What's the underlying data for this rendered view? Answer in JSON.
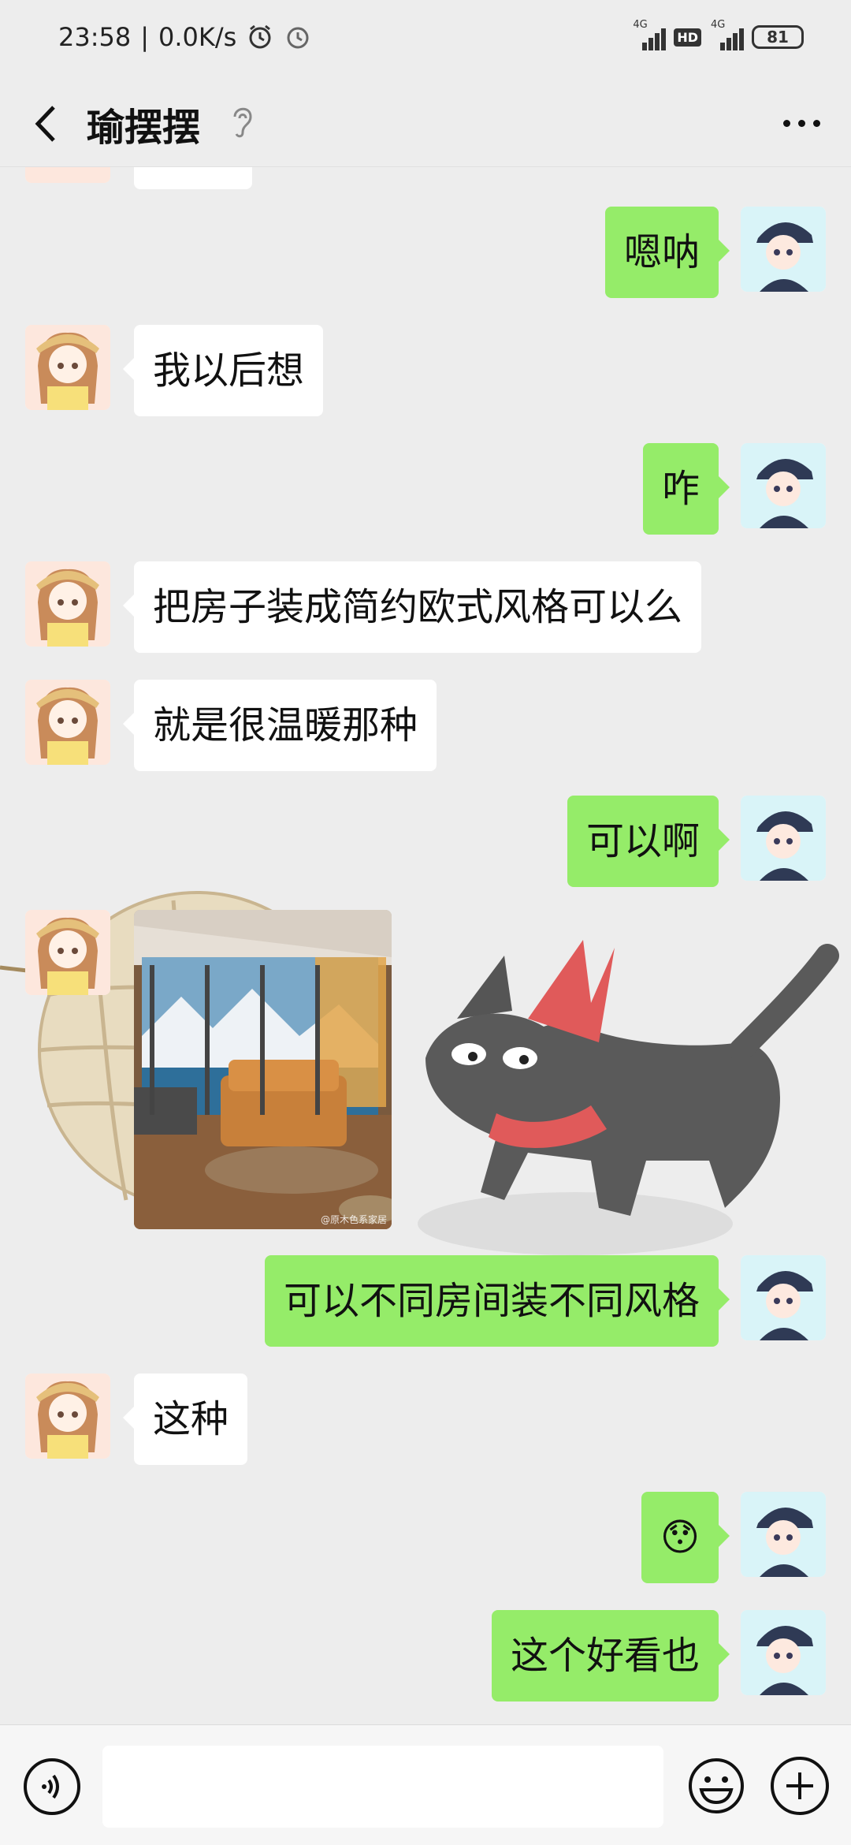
{
  "status_bar": {
    "time": "23:58",
    "net_speed": "0.0K/s",
    "network_1": "4G",
    "hd": "HD",
    "network_2": "4G",
    "battery": "81"
  },
  "header": {
    "title": "瑜摆摆",
    "icons": [
      "back-arrow-icon",
      "ear-icon",
      "more-icon"
    ]
  },
  "messages": [
    {
      "side": "right",
      "text": "嗯呐"
    },
    {
      "side": "left",
      "text": "我以后想"
    },
    {
      "side": "right",
      "text": "咋"
    },
    {
      "side": "left",
      "text": "把房子装成简约欧式风格可以么"
    },
    {
      "side": "left",
      "text": "就是很温暖那种"
    },
    {
      "side": "right",
      "text": "可以啊"
    },
    {
      "side": "left",
      "type": "image",
      "watermark": "@原木色系家居"
    },
    {
      "side": "right",
      "text": "可以不同房间装不同风格"
    },
    {
      "side": "left",
      "text": "这种"
    },
    {
      "side": "right",
      "text": "😯"
    },
    {
      "side": "right",
      "text": "这个好看也"
    }
  ],
  "input_bar": {
    "icons": [
      "voice-icon",
      "emoji-icon",
      "plus-icon"
    ]
  },
  "colors": {
    "background": "#ededed",
    "my_bubble": "#95ec69",
    "their_bubble": "#ffffff"
  }
}
